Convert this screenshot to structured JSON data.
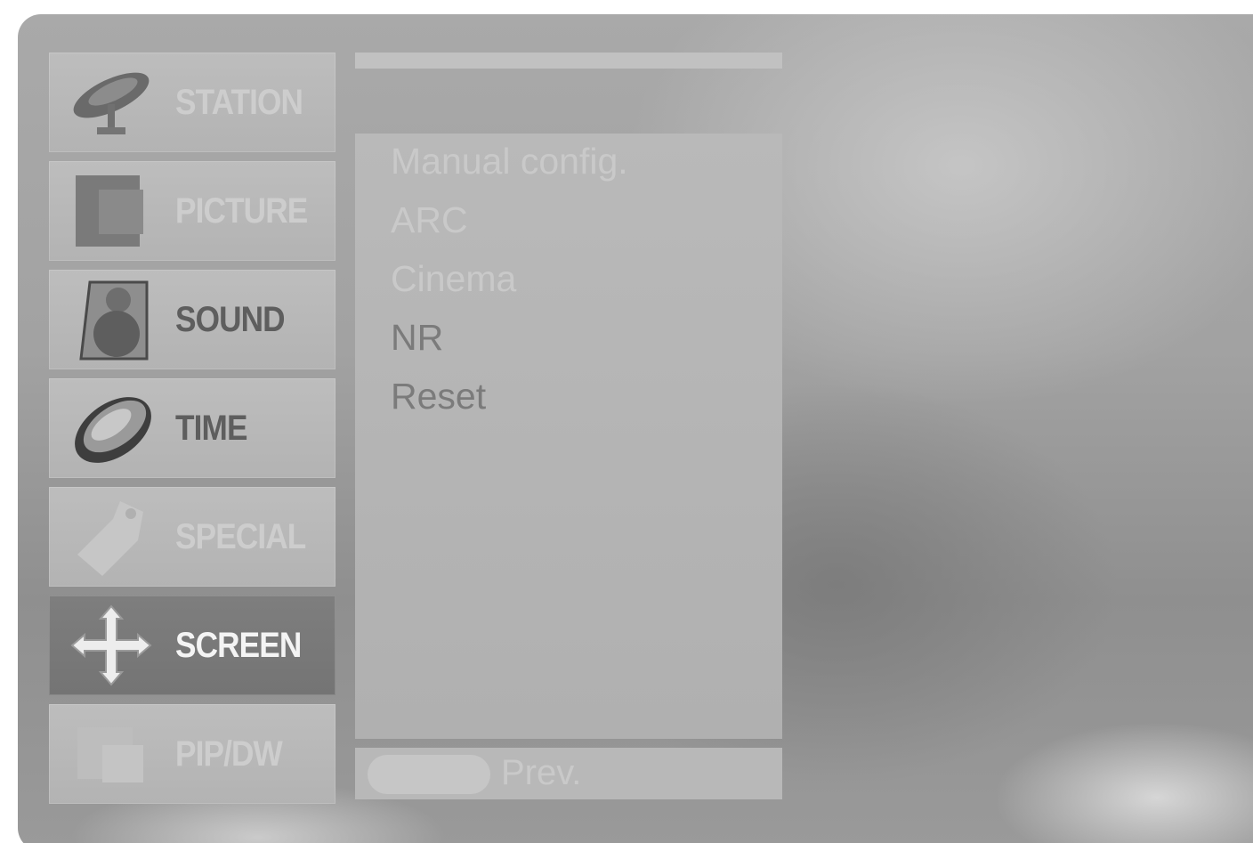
{
  "menu": {
    "items": [
      {
        "label": "STATION",
        "icon": "satellite-dish-icon",
        "state": "dim"
      },
      {
        "label": "PICTURE",
        "icon": "picture-icon",
        "state": "dim"
      },
      {
        "label": "SOUND",
        "icon": "speaker-icon",
        "state": "normal"
      },
      {
        "label": "TIME",
        "icon": "clock-icon",
        "state": "normal"
      },
      {
        "label": "SPECIAL",
        "icon": "tag-icon",
        "state": "dim"
      },
      {
        "label": "SCREEN",
        "icon": "move-arrows-icon",
        "state": "selected"
      },
      {
        "label": "PIP/DW",
        "icon": "pip-icon",
        "state": "dim"
      }
    ]
  },
  "submenu": {
    "items": [
      {
        "label": "Manual config.",
        "state": "dim"
      },
      {
        "label": "ARC",
        "state": "dim"
      },
      {
        "label": "Cinema",
        "state": "dim"
      },
      {
        "label": "NR",
        "state": "normal"
      },
      {
        "label": "Reset",
        "state": "normal"
      }
    ]
  },
  "footer": {
    "prev_label": "Prev."
  },
  "colors": {
    "selected_background": "#7a7a7a",
    "panel_background": "#b5b5b5",
    "dim_text": "#cdcdcd",
    "normal_text": "#5e5e5e"
  }
}
